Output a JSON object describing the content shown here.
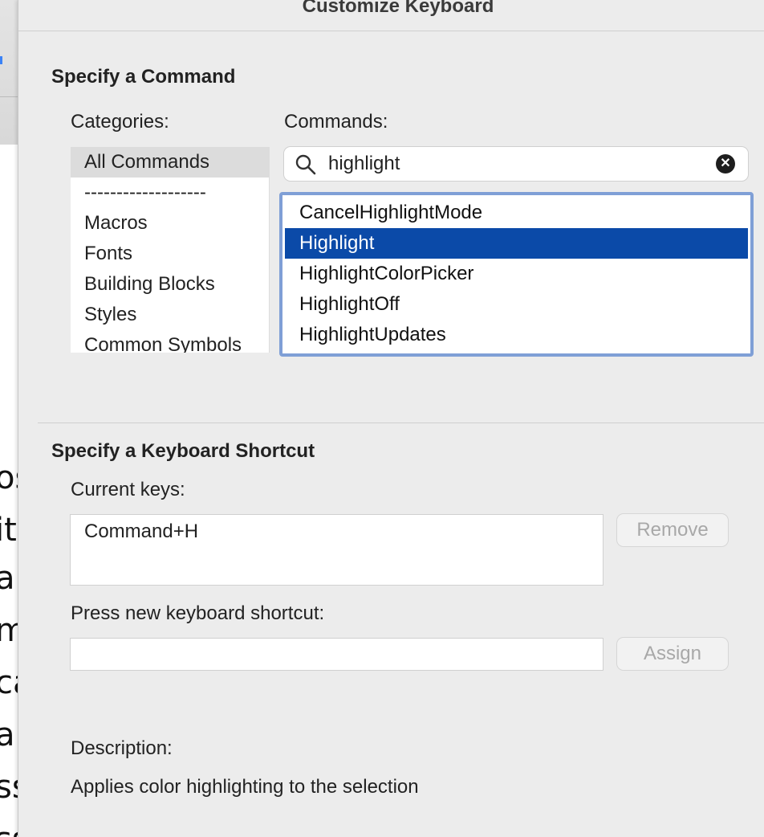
{
  "background_document": {
    "fragments": [
      "os",
      "it",
      "a",
      "m",
      "ca",
      "a",
      "ss",
      "ss"
    ]
  },
  "dialog": {
    "title": "Customize Keyboard",
    "command_section": {
      "heading": "Specify a Command",
      "categories_label": "Categories:",
      "categories": [
        "All Commands",
        "-------------------",
        "Macros",
        "Fonts",
        "Building Blocks",
        "Styles",
        "Common Symbols"
      ],
      "selected_category": "All Commands",
      "commands_label": "Commands:",
      "search": {
        "value": "highlight",
        "icon": "magnifier-icon",
        "clear_icon": "clear-icon"
      },
      "commands": [
        "CancelHighlightMode",
        "Highlight",
        "HighlightColorPicker",
        "HighlightOff",
        "HighlightUpdates"
      ],
      "selected_command": "Highlight",
      "selection_color": "#0b4aa8"
    },
    "shortcut_section": {
      "heading": "Specify a Keyboard Shortcut",
      "current_keys_label": "Current keys:",
      "current_keys": [
        "Command+H"
      ],
      "remove_label": "Remove",
      "new_shortcut_label": "Press new keyboard shortcut:",
      "new_shortcut_value": "",
      "assign_label": "Assign"
    },
    "description_label": "Description:",
    "description": "Applies color highlighting to the selection"
  }
}
